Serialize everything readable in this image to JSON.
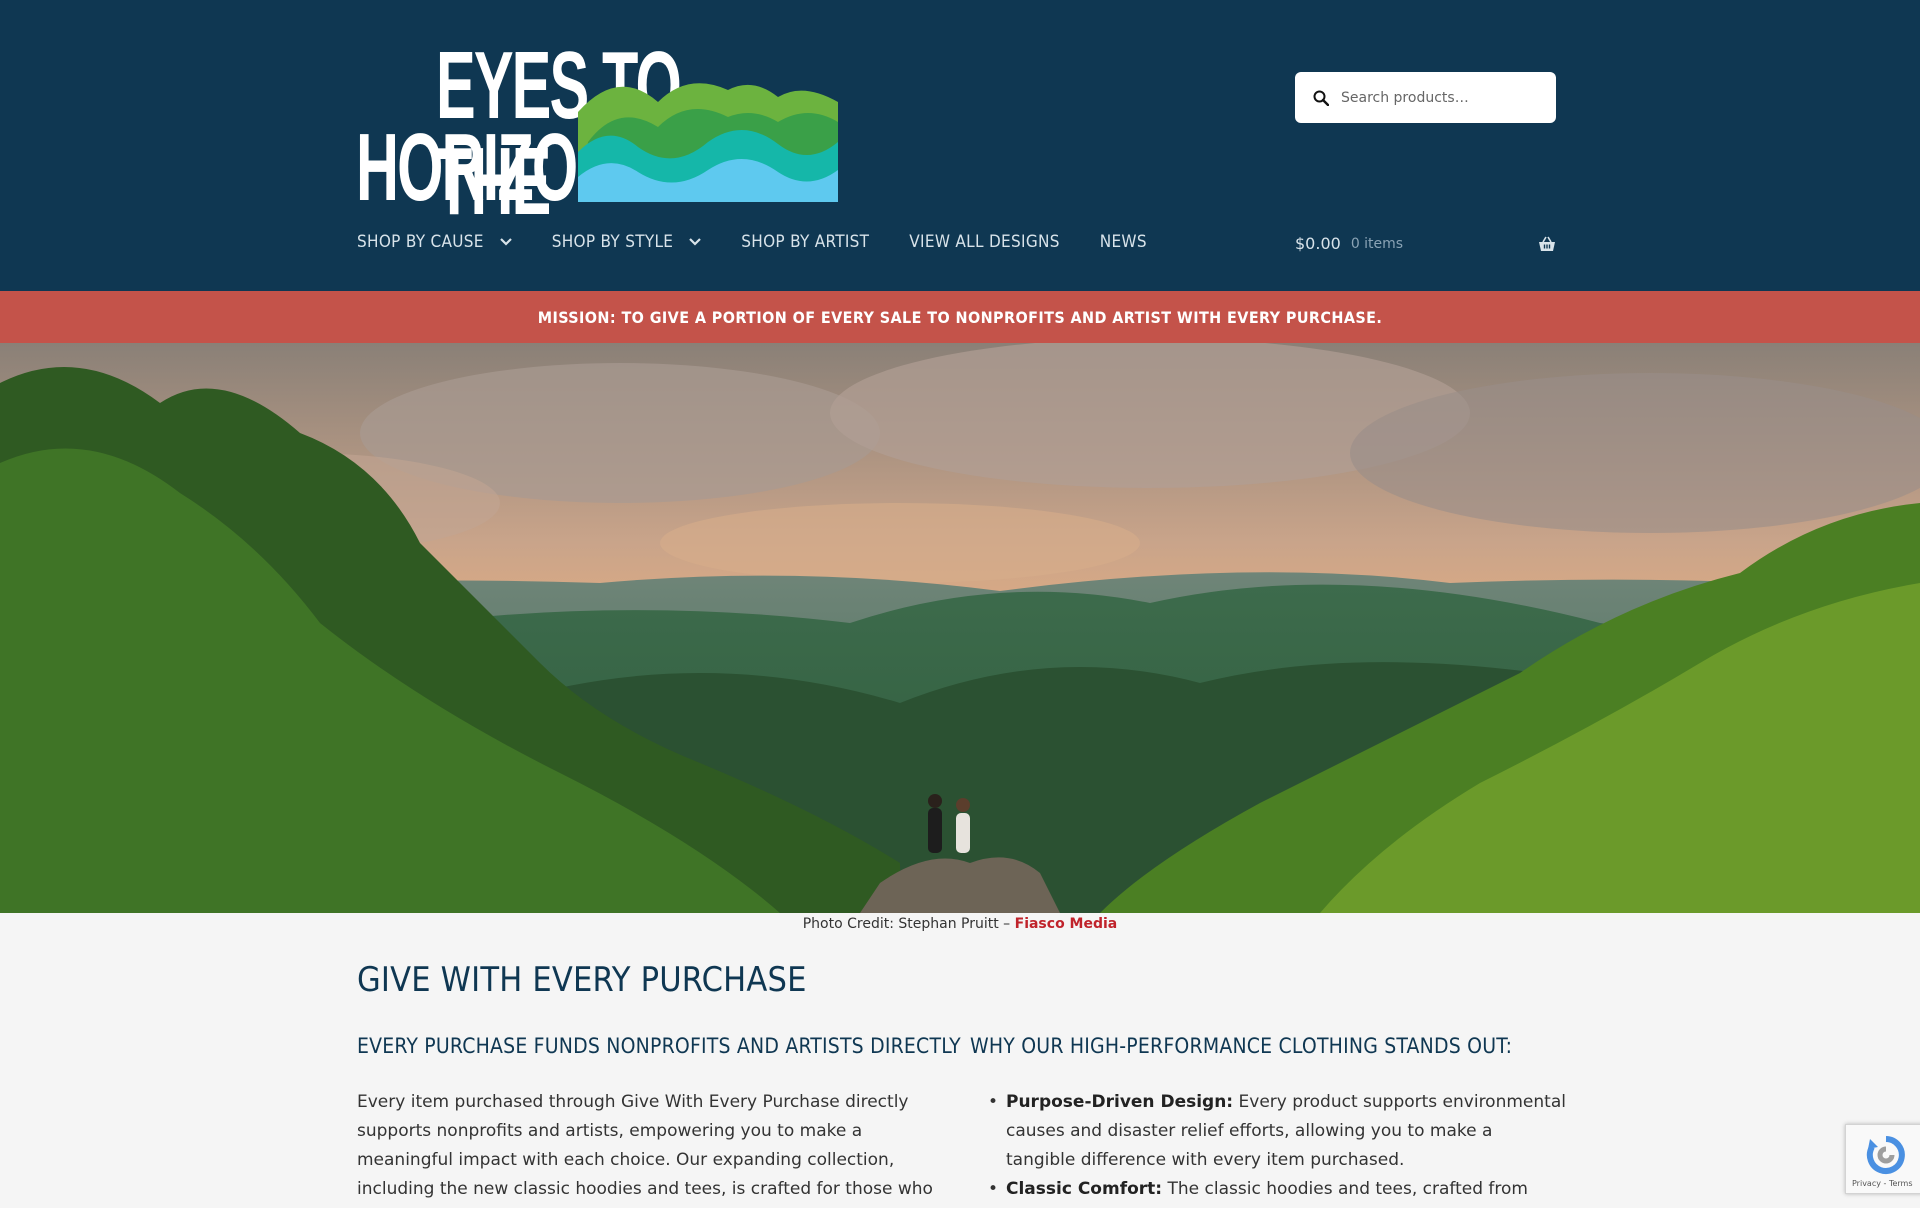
{
  "brand": {
    "logo_line1": "EYES TO THE",
    "logo_line2": "HORIZON",
    "colors": {
      "header_bg": "#0f3752",
      "mission_bg": "#c4534a",
      "accent_link": "#c0232b"
    }
  },
  "search": {
    "placeholder": "Search products…",
    "icon": "search-icon"
  },
  "nav": {
    "items": [
      {
        "label": "SHOP BY CAUSE",
        "has_dropdown": true
      },
      {
        "label": "SHOP BY STYLE",
        "has_dropdown": true
      },
      {
        "label": "SHOP BY ARTIST",
        "has_dropdown": false
      },
      {
        "label": "VIEW ALL DESIGNS",
        "has_dropdown": false
      },
      {
        "label": "NEWS",
        "has_dropdown": false
      }
    ]
  },
  "cart": {
    "amount": "$0.00",
    "count": "0 items",
    "icon": "basket-icon"
  },
  "mission": {
    "text": "MISSION: TO GIVE A PORTION OF EVERY SALE TO NONPROFITS AND ARTIST WITH EVERY PURCHASE."
  },
  "hero": {
    "credit_prefix": "Photo Credit: Stephan Pruitt – ",
    "credit_link": "Fiasco Media"
  },
  "content": {
    "title": "GIVE WITH EVERY PURCHASE",
    "left_heading": "EVERY PURCHASE FUNDS NONPROFITS AND ARTISTS DIRECTLY",
    "left_paragraph": "Every item purchased through Give With Every Purchase directly supports nonprofits and artists, empowering you to make a meaningful impact with each choice. Our expanding collection, including the new classic hoodies and tees, is crafted for those who value sustainability and",
    "right_heading": "WHY OUR HIGH-PERFORMANCE CLOTHING STANDS OUT:",
    "bullets": [
      {
        "term": "Purpose-Driven Design:",
        "text": " Every product supports environmental causes and disaster relief efforts, allowing you to make a tangible difference with every item purchased."
      },
      {
        "term": "Classic Comfort:",
        "text": " The classic hoodies and tees, crafted from"
      }
    ]
  },
  "recaptcha": {
    "text": "Privacy - Terms"
  }
}
